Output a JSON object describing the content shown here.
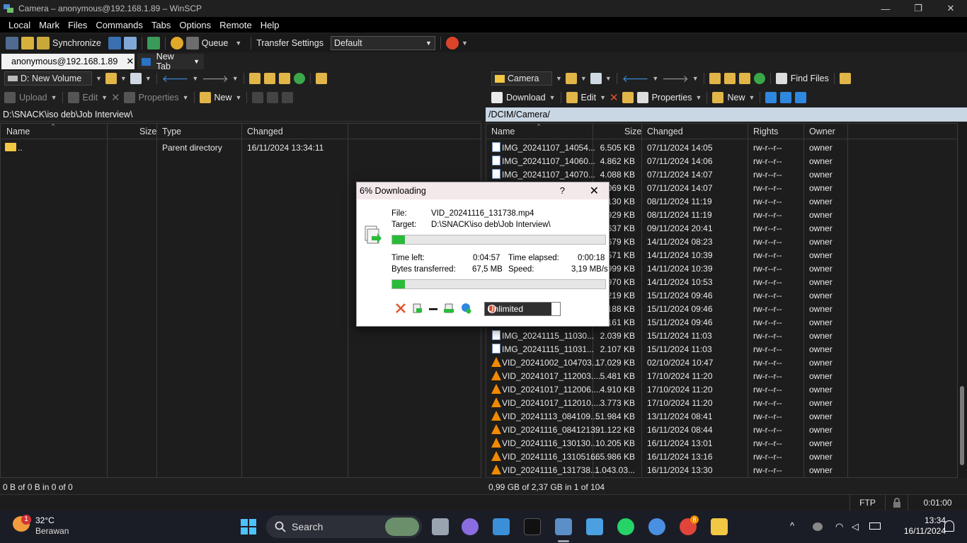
{
  "window": {
    "title": "Camera – anonymous@192.168.1.89 – WinSCP"
  },
  "menu": [
    "Local",
    "Mark",
    "Files",
    "Commands",
    "Tabs",
    "Options",
    "Remote",
    "Help"
  ],
  "toolbar": {
    "synchronize_label": "Synchronize",
    "queue_label": "Queue",
    "transfer_settings_label": "Transfer Settings",
    "transfer_settings_value": "Default"
  },
  "tabs": {
    "active": "anonymous@192.168.1.89",
    "new_tab": "New Tab"
  },
  "left": {
    "drive": "D: New Volume",
    "actions": {
      "upload": "Upload",
      "edit": "Edit",
      "properties": "Properties",
      "new": "New"
    },
    "path": "D:\\SNACK\\iso deb\\Job Interview\\",
    "columns": {
      "name": "Name",
      "size": "Size",
      "type": "Type",
      "changed": "Changed"
    },
    "rows": [
      {
        "name": "..",
        "size": "",
        "type": "Parent directory",
        "changed": "16/11/2024 13:34:11"
      }
    ],
    "status": "0 B of 0 B in 0 of 0"
  },
  "right": {
    "location": "Camera",
    "find_files": "Find Files",
    "actions": {
      "download": "Download",
      "edit": "Edit",
      "properties": "Properties",
      "new": "New"
    },
    "path": "/DCIM/Camera/",
    "columns": {
      "name": "Name",
      "size": "Size",
      "changed": "Changed",
      "rights": "Rights",
      "owner": "Owner"
    },
    "rows": [
      {
        "kind": "img",
        "name": "IMG_20241107_14054...",
        "size": "6.505 KB",
        "changed": "07/11/2024 14:05",
        "rights": "rw-r--r--",
        "owner": "owner"
      },
      {
        "kind": "img",
        "name": "IMG_20241107_14060...",
        "size": "4.862 KB",
        "changed": "07/11/2024 14:06",
        "rights": "rw-r--r--",
        "owner": "owner"
      },
      {
        "kind": "img",
        "name": "IMG_20241107_14070...",
        "size": "4.088 KB",
        "changed": "07/11/2024 14:07",
        "rights": "rw-r--r--",
        "owner": "owner"
      },
      {
        "kind": "img",
        "name": "",
        "size": ".069 KB",
        "changed": "07/11/2024 14:07",
        "rights": "rw-r--r--",
        "owner": "owner"
      },
      {
        "kind": "img",
        "name": "",
        "size": ".130 KB",
        "changed": "08/11/2024 11:19",
        "rights": "rw-r--r--",
        "owner": "owner"
      },
      {
        "kind": "img",
        "name": "",
        "size": ".929 KB",
        "changed": "08/11/2024 11:19",
        "rights": "rw-r--r--",
        "owner": "owner"
      },
      {
        "kind": "img",
        "name": "",
        "size": ".637 KB",
        "changed": "09/11/2024 20:41",
        "rights": "rw-r--r--",
        "owner": "owner"
      },
      {
        "kind": "img",
        "name": "",
        "size": ".679 KB",
        "changed": "14/11/2024 08:23",
        "rights": "rw-r--r--",
        "owner": "owner"
      },
      {
        "kind": "img",
        "name": "",
        "size": ".571 KB",
        "changed": "14/11/2024 10:39",
        "rights": "rw-r--r--",
        "owner": "owner"
      },
      {
        "kind": "img",
        "name": "",
        "size": ".999 KB",
        "changed": "14/11/2024 10:39",
        "rights": "rw-r--r--",
        "owner": "owner"
      },
      {
        "kind": "img",
        "name": "",
        "size": ".970 KB",
        "changed": "14/11/2024 10:53",
        "rights": "rw-r--r--",
        "owner": "owner"
      },
      {
        "kind": "img",
        "name": "",
        "size": ".219 KB",
        "changed": "15/11/2024 09:46",
        "rights": "rw-r--r--",
        "owner": "owner"
      },
      {
        "kind": "img",
        "name": "",
        "size": ".188 KB",
        "changed": "15/11/2024 09:46",
        "rights": "rw-r--r--",
        "owner": "owner"
      },
      {
        "kind": "img",
        "name": "",
        "size": ".161 KB",
        "changed": "15/11/2024 09:46",
        "rights": "rw-r--r--",
        "owner": "owner"
      },
      {
        "kind": "img",
        "name": "IMG_20241115_11030...",
        "size": "2.039 KB",
        "changed": "15/11/2024 11:03",
        "rights": "rw-r--r--",
        "owner": "owner"
      },
      {
        "kind": "img",
        "name": "IMG_20241115_11031...",
        "size": "2.107 KB",
        "changed": "15/11/2024 11:03",
        "rights": "rw-r--r--",
        "owner": "owner"
      },
      {
        "kind": "vid",
        "name": "VID_20241002_104703....",
        "size": "17.029 KB",
        "changed": "02/10/2024 10:47",
        "rights": "rw-r--r--",
        "owner": "owner"
      },
      {
        "kind": "vid",
        "name": "VID_20241017_112003....",
        "size": "5.481 KB",
        "changed": "17/10/2024 11:20",
        "rights": "rw-r--r--",
        "owner": "owner"
      },
      {
        "kind": "vid",
        "name": "VID_20241017_112006....",
        "size": "4.910 KB",
        "changed": "17/10/2024 11:20",
        "rights": "rw-r--r--",
        "owner": "owner"
      },
      {
        "kind": "vid",
        "name": "VID_20241017_112010....",
        "size": "3.773 KB",
        "changed": "17/10/2024 11:20",
        "rights": "rw-r--r--",
        "owner": "owner"
      },
      {
        "kind": "vid",
        "name": "VID_20241113_084109....",
        "size": "51.984 KB",
        "changed": "13/11/2024 08:41",
        "rights": "rw-r--r--",
        "owner": "owner"
      },
      {
        "kind": "vid",
        "name": "VID_20241116_084121....",
        "size": "391.122 KB",
        "changed": "16/11/2024 08:44",
        "rights": "rw-r--r--",
        "owner": "owner"
      },
      {
        "kind": "vid",
        "name": "VID_20241116_130130....",
        "size": "10.205 KB",
        "changed": "16/11/2024 13:01",
        "rights": "rw-r--r--",
        "owner": "owner"
      },
      {
        "kind": "vid",
        "name": "VID_20241116_131051....",
        "size": "665.986 KB",
        "changed": "16/11/2024 13:16",
        "rights": "rw-r--r--",
        "owner": "owner"
      },
      {
        "kind": "vid",
        "name": "VID_20241116_131738....",
        "size": "1.043.03...",
        "changed": "16/11/2024 13:30",
        "rights": "rw-r--r--",
        "owner": "owner"
      }
    ],
    "status": "0,99 GB of 2,37 GB in 1 of 104"
  },
  "statusbar": {
    "protocol": "FTP",
    "time": "0:01:00"
  },
  "dialog": {
    "title": "6% Downloading",
    "help": "?",
    "file_label": "File:",
    "file_value": "VID_20241116_131738.mp4",
    "target_label": "Target:",
    "target_value": "D:\\SNACK\\iso deb\\Job Interview\\",
    "file_progress": 0.06,
    "time_left_label": "Time left:",
    "time_left_value": "0:04:57",
    "time_elapsed_label": "Time elapsed:",
    "time_elapsed_value": "0:00:18",
    "bytes_label": "Bytes transferred:",
    "bytes_value": "67,5 MB",
    "speed_label": "Speed:",
    "speed_value": "3,19 MB/s",
    "total_progress": 0.06,
    "speed_limit": "Unlimited"
  },
  "taskbar": {
    "weather_badge": "1",
    "temperature": "32°C",
    "condition": "Berawan",
    "search_label": "Search",
    "chrome_badge": "8",
    "time": "13:34",
    "date": "16/11/2024"
  },
  "colors": {
    "accent": "#0078d4",
    "progress": "#2bbb3a",
    "path_bar_active": "#c9d6e3",
    "dialog_title": "#f3e8ea"
  }
}
